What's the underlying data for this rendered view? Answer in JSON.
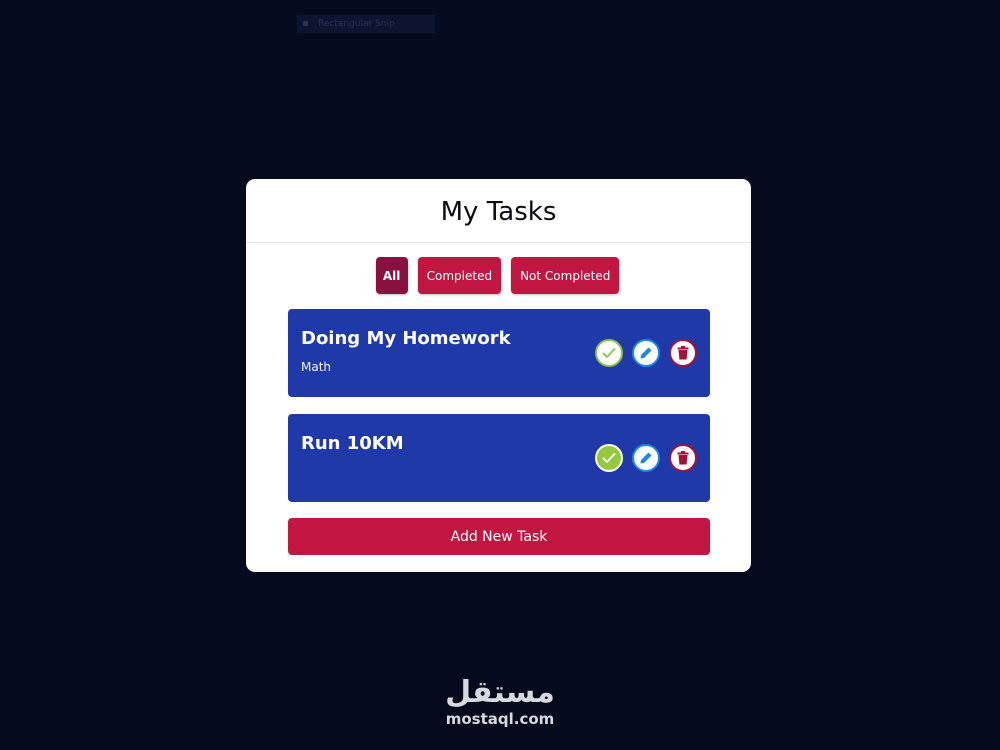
{
  "ghost_bar": {
    "label": "Rectangular Snip"
  },
  "card": {
    "title": "My Tasks"
  },
  "filters": [
    {
      "label": "All",
      "active": true
    },
    {
      "label": "Completed",
      "active": false
    },
    {
      "label": "Not Completed",
      "active": false
    }
  ],
  "tasks": [
    {
      "title": "Doing My Homework",
      "category": "Math",
      "completed": false
    },
    {
      "title": "Run 10KM",
      "category": "",
      "completed": true
    }
  ],
  "task_actions": {
    "complete_icon": "check-icon",
    "edit_icon": "pencil-icon",
    "delete_icon": "trash-icon"
  },
  "add_button": {
    "label": "Add New Task"
  },
  "watermark": {
    "logo_text": "مستقل",
    "url": "mostaql.com"
  },
  "colors": {
    "background": "#050a1c",
    "task_bg": "#1f3aa8",
    "accent": "#c0163f",
    "active_filter": "#8a1040",
    "complete": "#8bc34a",
    "edit": "#1e88e5",
    "delete": "#a3123a"
  }
}
